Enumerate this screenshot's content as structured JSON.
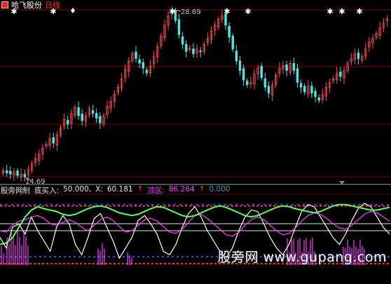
{
  "header": {
    "stock_name": "哈飞股份",
    "period": "日线"
  },
  "price_panel": {
    "high_label": "28.69",
    "low_label": "14.69",
    "colors": {
      "up": "#ff5050",
      "down": "#54e0e0",
      "grid": "#8b0000"
    }
  },
  "indicator_bar": {
    "name": "股旁网制",
    "buy_label": "底买入:",
    "buy_value": "50.000,",
    "x_label": "X:",
    "x_value": "60.181",
    "top_label": "顶区:",
    "top_value": "86.264",
    "last_value": "0.000",
    "arrow": "↑"
  },
  "watermark": {
    "text": "股旁网 www.gupang.com"
  },
  "chart_data": {
    "type": "candlestick",
    "ylim": [
      14.69,
      28.69
    ],
    "annotations": [
      "28.69",
      "14.69"
    ],
    "price_path": [
      15.2,
      15.0,
      14.9,
      15.1,
      14.8,
      14.9,
      14.7,
      15.3,
      15.8,
      16.2,
      16.6,
      17.1,
      17.4,
      17.9,
      17.5,
      18.2,
      18.8,
      19.5,
      19.1,
      20.0,
      20.5,
      19.8,
      19.4,
      19.8,
      20.4,
      20.0,
      19.6,
      19.2,
      19.8,
      20.6,
      21.0,
      21.6,
      22.2,
      22.9,
      23.7,
      24.4,
      25.0,
      24.6,
      24.2,
      23.8,
      23.4,
      24.0,
      24.8,
      25.6,
      26.5,
      27.4,
      28.2,
      28.69,
      27.8,
      26.6,
      25.8,
      25.2,
      25.5,
      25.0,
      25.4,
      25.2,
      25.8,
      26.3,
      26.9,
      27.4,
      27.9,
      28.2,
      27.4,
      26.4,
      25.4,
      24.4,
      23.6,
      22.8,
      22.4,
      22.6,
      23.3,
      23.8,
      23.0,
      22.2,
      21.7,
      22.4,
      23.2,
      23.8,
      24.0,
      23.6,
      24.2,
      23.6,
      22.6,
      22.2,
      21.8,
      22.3,
      21.7,
      21.4,
      21.1,
      21.6,
      22.2,
      22.6,
      22.9,
      23.4,
      23.1,
      23.6,
      24.2,
      24.6,
      25.0,
      24.6,
      24.8,
      25.4,
      26.0,
      26.3,
      26.7,
      27.2,
      27.6,
      27.9
    ],
    "markers": [
      "diamond-up",
      "star",
      "diamond",
      "star",
      "star",
      "star",
      "star",
      "star"
    ],
    "overlay_series": [
      {
        "name": "white_line",
        "color": "#ffffff",
        "values": [
          40,
          25,
          55,
          60,
          45,
          70,
          50,
          35,
          20,
          55,
          72,
          60,
          30,
          15,
          40,
          68,
          75,
          55,
          35,
          10,
          25,
          40,
          65,
          72,
          60,
          45,
          20,
          15,
          30,
          55,
          75,
          85,
          70,
          50,
          35,
          20,
          10,
          25,
          50,
          70,
          80,
          78,
          60,
          40,
          25,
          15,
          30,
          55,
          78,
          88,
          85,
          70,
          55,
          40,
          30,
          45,
          65,
          82,
          90,
          85,
          70,
          55,
          45
        ]
      },
      {
        "name": "magenta_line",
        "color": "#ff40ff",
        "values": [
          50,
          48,
          58,
          64,
          66,
          70,
          72,
          68,
          60,
          58,
          62,
          66,
          62,
          55,
          50,
          58,
          66,
          70,
          65,
          56,
          48,
          50,
          58,
          66,
          68,
          64,
          56,
          48,
          46,
          52,
          62,
          72,
          74,
          68,
          60,
          52,
          44,
          42,
          48,
          58,
          66,
          70,
          66,
          58,
          50,
          44,
          46,
          54,
          64,
          72,
          76,
          74,
          68,
          60,
          54,
          52,
          58,
          66,
          74,
          78,
          76,
          70,
          64
        ]
      },
      {
        "name": "green_line",
        "color": "#60ff60",
        "values": [
          30,
          32,
          40,
          55,
          70,
          80,
          85,
          82,
          80,
          78,
          74,
          72,
          74,
          78,
          82,
          85,
          86,
          84,
          80,
          76,
          74,
          72,
          74,
          78,
          82,
          85,
          84,
          80,
          76,
          72,
          70,
          72,
          76,
          80,
          84,
          86,
          84,
          80,
          76,
          72,
          70,
          72,
          76,
          80,
          84,
          86,
          85,
          82,
          80,
          78,
          76,
          78,
          82,
          86,
          88,
          88,
          86,
          84,
          82,
          80,
          80,
          82,
          84
        ]
      }
    ],
    "bands": {
      "top_red": 86.264,
      "buy_level": 50,
      "x_level": 60.181,
      "blue_low": 12
    }
  }
}
